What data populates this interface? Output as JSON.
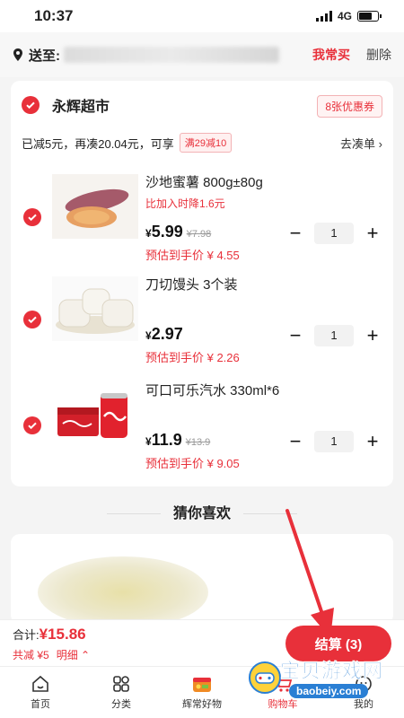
{
  "status": {
    "time": "10:37",
    "network": "4G"
  },
  "header": {
    "ship_to_label": "送至:",
    "often_buy": "我常买",
    "delete": "删除"
  },
  "store": {
    "name": "永辉超市",
    "coupon_badge": "8张优惠券",
    "promo_text": "已减5元，再凑20.04元，可享",
    "promo_tag": "满29减10",
    "promo_link": "去凑单"
  },
  "items": [
    {
      "title": "沙地蜜薯 800g±80g",
      "note": "比加入时降1.6元",
      "price": "5.99",
      "old_price": "¥7.98",
      "estimate": "预估到手价 ¥ 4.55",
      "qty": "1"
    },
    {
      "title": "刀切馒头 3个装",
      "note": "",
      "price": "2.97",
      "old_price": "",
      "estimate": "预估到手价 ¥ 2.26",
      "qty": "1"
    },
    {
      "title": "可口可乐汽水 330ml*6",
      "note": "",
      "price": "11.9",
      "old_price": "¥13.9",
      "estimate": "预估到手价 ¥ 9.05",
      "qty": "1"
    }
  ],
  "currency": "¥",
  "recommend": {
    "title": "猜你喜欢"
  },
  "checkout": {
    "total_label": "合计:",
    "total": "¥15.86",
    "saved": "共减 ¥5",
    "detail": "明细",
    "button": "结算 (3)"
  },
  "tabs": [
    {
      "label": "首页",
      "icon": "home-icon"
    },
    {
      "label": "分类",
      "icon": "category-icon"
    },
    {
      "label": "辉常好物",
      "icon": "goods-icon"
    },
    {
      "label": "购物车",
      "icon": "cart-icon"
    },
    {
      "label": "我的",
      "icon": "profile-icon"
    }
  ],
  "watermark": {
    "title": "宝贝游戏网",
    "url": "baobeiy.com"
  },
  "colors": {
    "accent": "#e8303a",
    "watermark_blue": "#2a7fd4"
  }
}
